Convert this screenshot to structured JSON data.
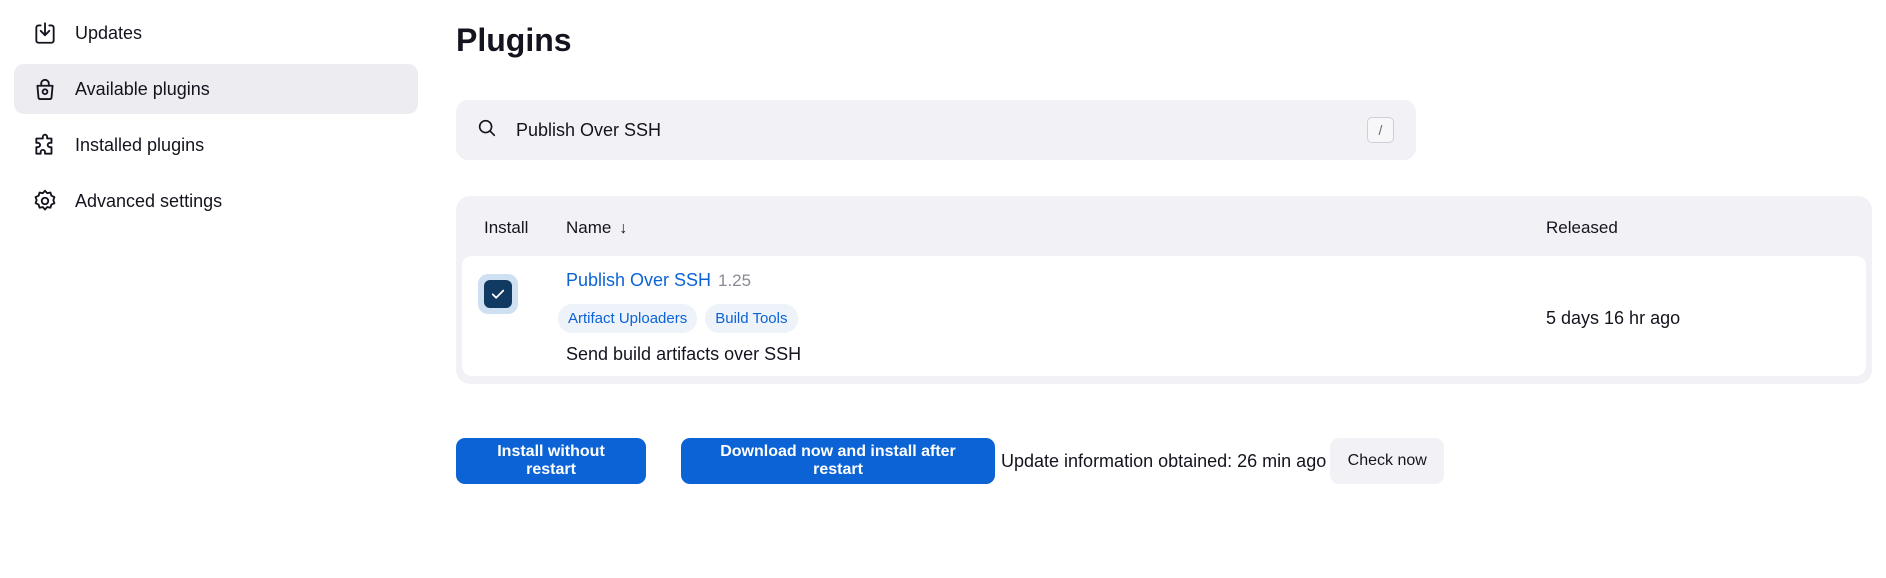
{
  "sidebar": {
    "items": [
      {
        "label": "Updates",
        "icon": "download-icon"
      },
      {
        "label": "Available plugins",
        "icon": "shopping-bag-icon",
        "active": true
      },
      {
        "label": "Installed plugins",
        "icon": "puzzle-icon"
      },
      {
        "label": "Advanced settings",
        "icon": "gear-icon"
      }
    ]
  },
  "page": {
    "title": "Plugins"
  },
  "search": {
    "value": "Publish Over SSH",
    "shortcut": "/",
    "icon": "search-icon"
  },
  "table": {
    "headers": {
      "install": "Install",
      "name": "Name",
      "name_sort": "↓",
      "released": "Released"
    },
    "rows": [
      {
        "checked": true,
        "name": "Publish Over SSH",
        "version": "1.25",
        "tags": [
          "Artifact Uploaders",
          "Build Tools"
        ],
        "description": "Send build artifacts over SSH",
        "released": "5 days 16 hr ago"
      }
    ]
  },
  "actions": {
    "install_without_restart": "Install without restart",
    "download_install_after_restart": "Download now and install after restart",
    "update_info": "Update information obtained: 26 min ago",
    "check_now": "Check now"
  },
  "colors": {
    "accent": "#0b63d6",
    "active_bg": "#ececf1",
    "checkbox": "#103a61"
  }
}
